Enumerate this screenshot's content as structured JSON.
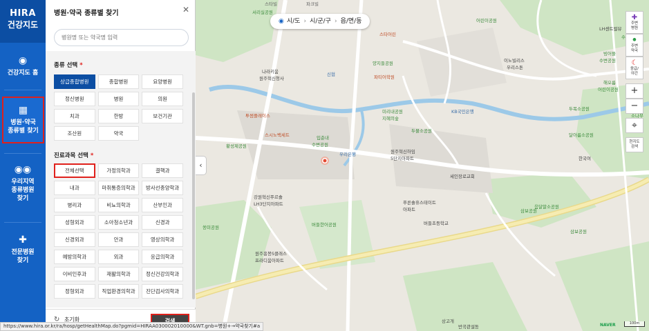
{
  "logo": {
    "line1": "HIRA",
    "line2": "건강지도"
  },
  "nav": {
    "items": [
      {
        "label": "건강지도 홈"
      },
      {
        "label": "병원·약국\n종류별 찾기"
      },
      {
        "label": "우리지역\n종류병원\n찾기"
      },
      {
        "label": "전문병원\n찾기"
      }
    ]
  },
  "panel": {
    "title": "병원·약국 종류별 찾기",
    "search_placeholder": "병원명 또는 약국명 입력",
    "type_section": {
      "title": "종류 선택",
      "req": "*"
    },
    "types": [
      "상급종합병원",
      "종합병원",
      "요양병원",
      "정신병원",
      "병원",
      "의원",
      "치과",
      "한방",
      "보건기관",
      "조산원",
      "약국"
    ],
    "selected_type": "상급종합병원",
    "dept_section": {
      "title": "진료과목 선택",
      "req": "*"
    },
    "depts": [
      "전체선택",
      "가정의학과",
      "결핵과",
      "내과",
      "마취통증의학과",
      "방사선종양학과",
      "병리과",
      "비뇨의학과",
      "산부인과",
      "성형외과",
      "소아청소년과",
      "신경과",
      "신경외과",
      "안과",
      "영상의학과",
      "예방의학과",
      "외과",
      "응급의학과",
      "이비인후과",
      "재활의학과",
      "정신건강의학과",
      "정형외과",
      "직업환경의학과",
      "진단검사의학과"
    ],
    "selected_dept": "전체선택",
    "reset_label": "초기화",
    "search_button": "검색"
  },
  "map": {
    "breadcrumb": {
      "sido": "시/도",
      "sigungu": "시/군/구",
      "dong": "읍/면/동"
    },
    "tools": {
      "hospital": "주변\n병원",
      "pharmacy": "주변\n약국",
      "emergency": "응급/\n야간",
      "zoom_in": "+",
      "zoom_out": "−",
      "locate": "현지도\n검색"
    },
    "labels": [
      "서리실공원",
      "스타빌",
      "파크빌",
      "어린이공원",
      "LH센트럴뷰",
      "수변공원",
      "나라키움",
      "원주혁신청사",
      "신협",
      "양지들공원",
      "스타어린",
      "파티어학원",
      "이노빌리스",
      "우리스톤",
      "빙어뜰",
      "수변공원",
      "해오름",
      "어린이공원",
      "투썸플레이스",
      "미리내공원",
      "지혜의숲",
      "KB국민은행",
      "두목소공원",
      "달아름소공원",
      "소나무",
      "황성제공원",
      "스시노백세트",
      "두물소공원",
      "입춘내",
      "수변공원",
      "우리은행",
      "원주혁신하임",
      "5단지아파트",
      "한국여",
      "세인장로교회",
      "강원혁신푸르솔",
      "LH3단지아파트",
      "푸른솔휴스테이트",
      "아파트",
      "버들초등학교",
      "버들한어공원",
      "쏭미공원",
      "삼보공원",
      "음달말소공원",
      "원주흥봉S클래스",
      "프라디움아파트",
      "삼보공원",
      "상고개",
      "반곡관설동"
    ],
    "naver": "NAVER",
    "scale": "100m"
  },
  "status_url": "https://www.hira.or.kr/ra/hosp/getHealthMap.do?pgmid=HIRAA030002010000&WT.gnb=병원+→약국찾기#a"
}
